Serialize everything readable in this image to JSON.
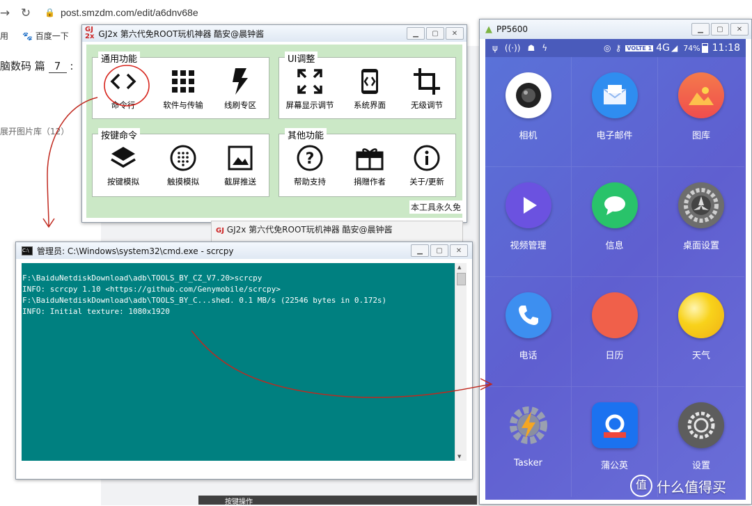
{
  "browser": {
    "url": "post.smzdm.com/edit/a6dnv68e",
    "bookmarks": [
      "用",
      "百度一下"
    ],
    "page_left_text_1": "脑数码 篇",
    "page_left_value_1": "7",
    "page_left_text_2": "展开图片库（12）",
    "footer_text": "按键操作"
  },
  "tool_window": {
    "title": "GJ2x 第六代免ROOT玩机神器  酷安@晨钟酱",
    "groups": [
      {
        "title": "通用功能",
        "buttons": [
          "命令行",
          "软件与传输",
          "线刷专区"
        ]
      },
      {
        "title": "UI调整",
        "buttons": [
          "屏幕显示调节",
          "系统界面",
          "无级调节"
        ]
      },
      {
        "title": "按键命令",
        "buttons": [
          "按键模拟",
          "触摸模拟",
          "截屏推送"
        ]
      },
      {
        "title": "其他功能",
        "buttons": [
          "帮助支持",
          "捐赠作者",
          "关于/更新"
        ]
      }
    ],
    "footer_text": "本工具永久免"
  },
  "tool_window_2": {
    "title": "GJ2x 第六代免ROOT玩机神器  酷安@晨钟酱"
  },
  "cmd_window": {
    "title": "管理员: C:\\Windows\\system32\\cmd.exe - scrcpy",
    "lines": [
      "F:\\BaiduNetdiskDownload\\adb\\TOOLS_BY_CZ_V7.20>scrcpy",
      "INFO: scrcpy 1.10 <https://github.com/Genymobile/scrcpy>",
      "F:\\BaiduNetdiskDownload\\adb\\TOOLS_BY_C...shed. 0.1 MB/s (22546 bytes in 0.172s)",
      "INFO: Initial texture: 1080x1920"
    ]
  },
  "phone_window": {
    "title": "PP5600",
    "status": {
      "volte": "VOLTE 1",
      "network": "4G",
      "battery": "74%",
      "time": "11:18"
    },
    "apps": [
      {
        "label": "相机",
        "icon": "camera-icon",
        "color": "#ffffff"
      },
      {
        "label": "电子邮件",
        "icon": "mail-icon",
        "color": "#2f8df0"
      },
      {
        "label": "图库",
        "icon": "gallery-icon",
        "color": "#f4594b"
      },
      {
        "label": "视频管理",
        "icon": "play-icon",
        "color": "#6b52e0"
      },
      {
        "label": "信息",
        "icon": "message-icon",
        "color": "#29c36a"
      },
      {
        "label": "桌面设置",
        "icon": "gear-icon",
        "color": "#6d6d6d"
      },
      {
        "label": "电话",
        "icon": "phone-icon",
        "color": "#3d8ff0"
      },
      {
        "label": "日历",
        "icon": "calendar-icon",
        "color": "#f0604a"
      },
      {
        "label": "天气",
        "icon": "weather-icon",
        "color": "#f5c21b"
      },
      {
        "label": "Tasker",
        "icon": "tasker-icon",
        "color": "#8a8fa0"
      },
      {
        "label": "蒲公英",
        "icon": "dandelion-icon",
        "color": "#1b72f0"
      },
      {
        "label": "设置",
        "icon": "settings-icon",
        "color": "#5d5d5d"
      }
    ]
  },
  "watermark": "什么值得买"
}
